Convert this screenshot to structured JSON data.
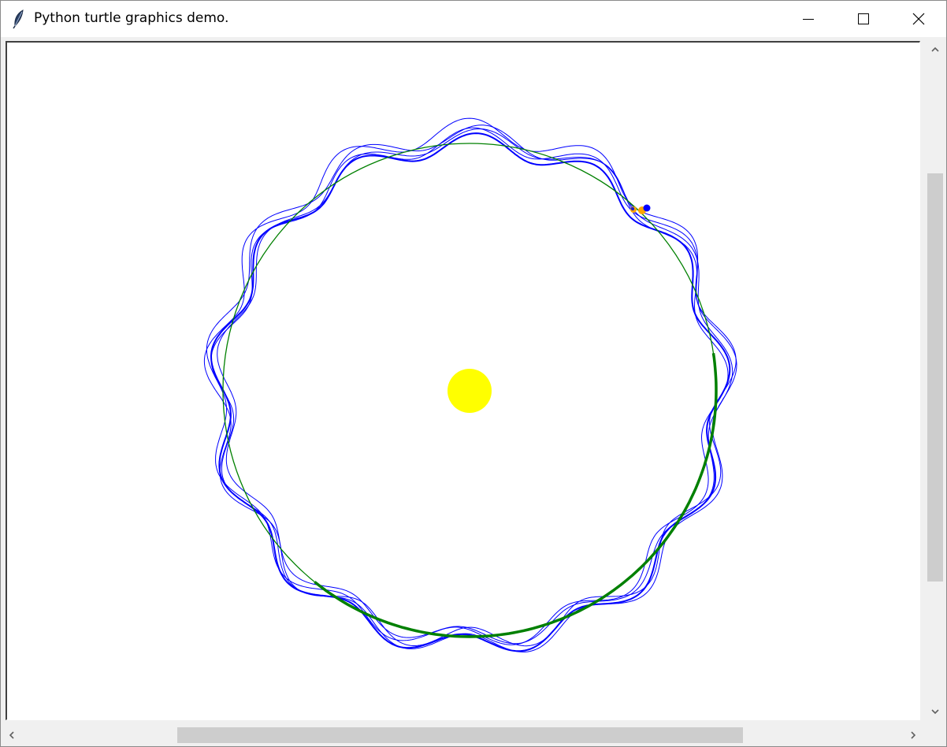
{
  "window": {
    "title": "Python turtle graphics demo.",
    "icon": "feather-icon",
    "controls": [
      "minimize-icon",
      "maximize-icon",
      "close-icon"
    ]
  },
  "canvas": {
    "background": "#ffffff",
    "elements": [
      {
        "name": "sun",
        "color": "#ffff00"
      },
      {
        "name": "orbit-circle",
        "color": "#008000"
      },
      {
        "name": "planet-trajectory",
        "color": "#0000ff"
      },
      {
        "name": "moon-turtle",
        "color": "#ffa500"
      }
    ]
  },
  "scrollbars": {
    "vertical": {
      "up_icon": "chevron-up-icon",
      "down_icon": "chevron-down-icon"
    },
    "horizontal": {
      "left_icon": "chevron-left-icon",
      "right_icon": "chevron-right-icon"
    }
  }
}
